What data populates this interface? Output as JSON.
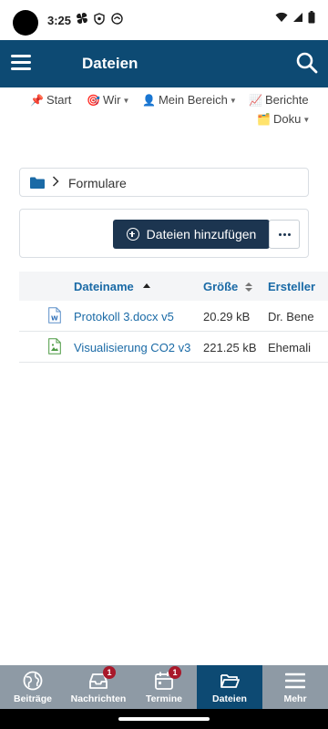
{
  "status_bar": {
    "time": "3:25"
  },
  "app_bar": {
    "title": "Dateien"
  },
  "top_nav": {
    "items": [
      {
        "emoji": "📌",
        "label": "Start"
      },
      {
        "emoji": "🎯",
        "label": "Wir"
      },
      {
        "emoji": "👤",
        "label": "Mein Bereich"
      },
      {
        "emoji": "📈",
        "label": "Berichte"
      },
      {
        "emoji": "🗂️",
        "label": "Doku"
      }
    ]
  },
  "breadcrumb": {
    "current": "Formulare"
  },
  "toolbar": {
    "add_label": "Dateien hinzufügen"
  },
  "table": {
    "columns": [
      "Dateiname",
      "Größe",
      "Ersteller"
    ],
    "rows": [
      {
        "name": "Protokoll 3.docx v5",
        "size": "20.29 kB",
        "creator": "Dr. Bene",
        "icon": "word-file-icon"
      },
      {
        "name": "Visualisierung CO2 v3",
        "size": "221.25 kB",
        "creator": "Ehemali",
        "icon": "image-file-icon"
      }
    ]
  },
  "bottom_nav": {
    "items": [
      {
        "label": "Beiträge",
        "icon": "globe-icon"
      },
      {
        "label": "Nachrichten",
        "icon": "inbox-icon",
        "badge": "1"
      },
      {
        "label": "Termine",
        "icon": "calendar-icon",
        "badge": "1"
      },
      {
        "label": "Dateien",
        "icon": "folder-icon",
        "active": true
      },
      {
        "label": "Mehr",
        "icon": "menu-icon"
      }
    ]
  },
  "colors": {
    "primary": "#0d4a73",
    "button_dark": "#1c3550",
    "link": "#1a6aa6",
    "bottom_nav": "#8e9aa5",
    "badge": "#a8182a"
  }
}
